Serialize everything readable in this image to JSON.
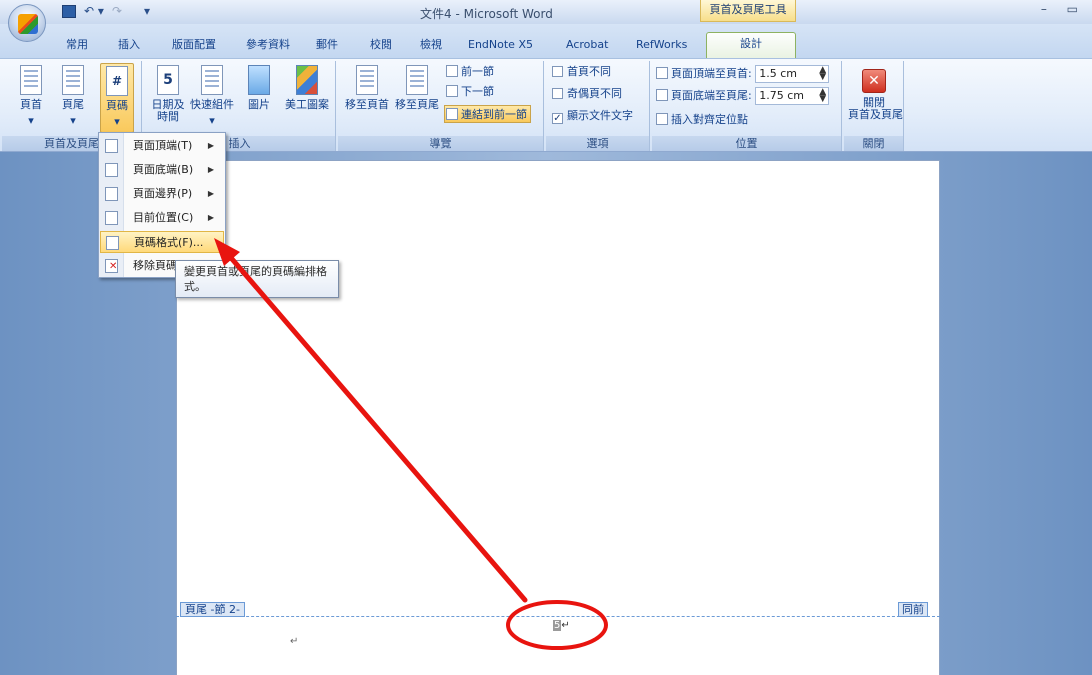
{
  "titlebar": {
    "doc_title": "文件4 - Microsoft Word",
    "context_tool": "頁首及頁尾工具",
    "window_controls": "– ▭"
  },
  "tabs": [
    "常用",
    "插入",
    "版面配置",
    "參考資料",
    "郵件",
    "校閱",
    "檢視",
    "EndNote X5",
    "Acrobat",
    "RefWorks",
    "設計"
  ],
  "ribbon": {
    "group1": {
      "label": "頁首及頁尾",
      "header": "頁首",
      "footer": "頁尾",
      "page_number": "頁碼"
    },
    "group2": {
      "label": "插入",
      "date_time": "日期及\n時間",
      "quick_parts": "快速組件",
      "picture": "圖片",
      "clip_art": "美工圖案"
    },
    "group3": {
      "label": "導覽",
      "goto_header": "移至頁首",
      "goto_footer": "移至頁尾",
      "prev_section": "前一節",
      "next_section": "下一節",
      "link_prev": "連結到前一節"
    },
    "group4": {
      "label": "選項",
      "different_first": "首頁不同",
      "different_odd_even": "奇偶頁不同",
      "show_doc_text": "顯示文件文字"
    },
    "group5": {
      "label": "位置",
      "header_from_top": "頁面頂端至頁首:",
      "header_from_top_value": "1.5 cm",
      "footer_from_bottom": "頁面底端至頁尾:",
      "footer_from_bottom_value": "1.75 cm",
      "insert_align_tab": "插入對齊定位點"
    },
    "group6": {
      "label": "關閉",
      "close": "關閉\n頁首及頁尾"
    }
  },
  "menu": {
    "items": [
      {
        "label": "頁面頂端(T)",
        "arrow": "▶"
      },
      {
        "label": "頁面底端(B)",
        "arrow": "▶"
      },
      {
        "label": "頁面邊界(P)",
        "arrow": "▶"
      },
      {
        "label": "目前位置(C)",
        "arrow": "▶"
      },
      {
        "label": "頁碼格式(F)...",
        "arrow": ""
      },
      {
        "label": "移除頁碼",
        "arrow": ""
      }
    ]
  },
  "tooltip": "變更頁首或頁尾的頁碼編排格式。",
  "document": {
    "footer_tag": "頁尾 -節 2-",
    "same_as_prev_tag": "同前",
    "page_number_value": "5",
    "para_mark": "↵"
  },
  "colors": {
    "annotation_red": "#e8140f",
    "workspace_blue": "#6d92c2",
    "ribbon_text": "#15428b"
  }
}
